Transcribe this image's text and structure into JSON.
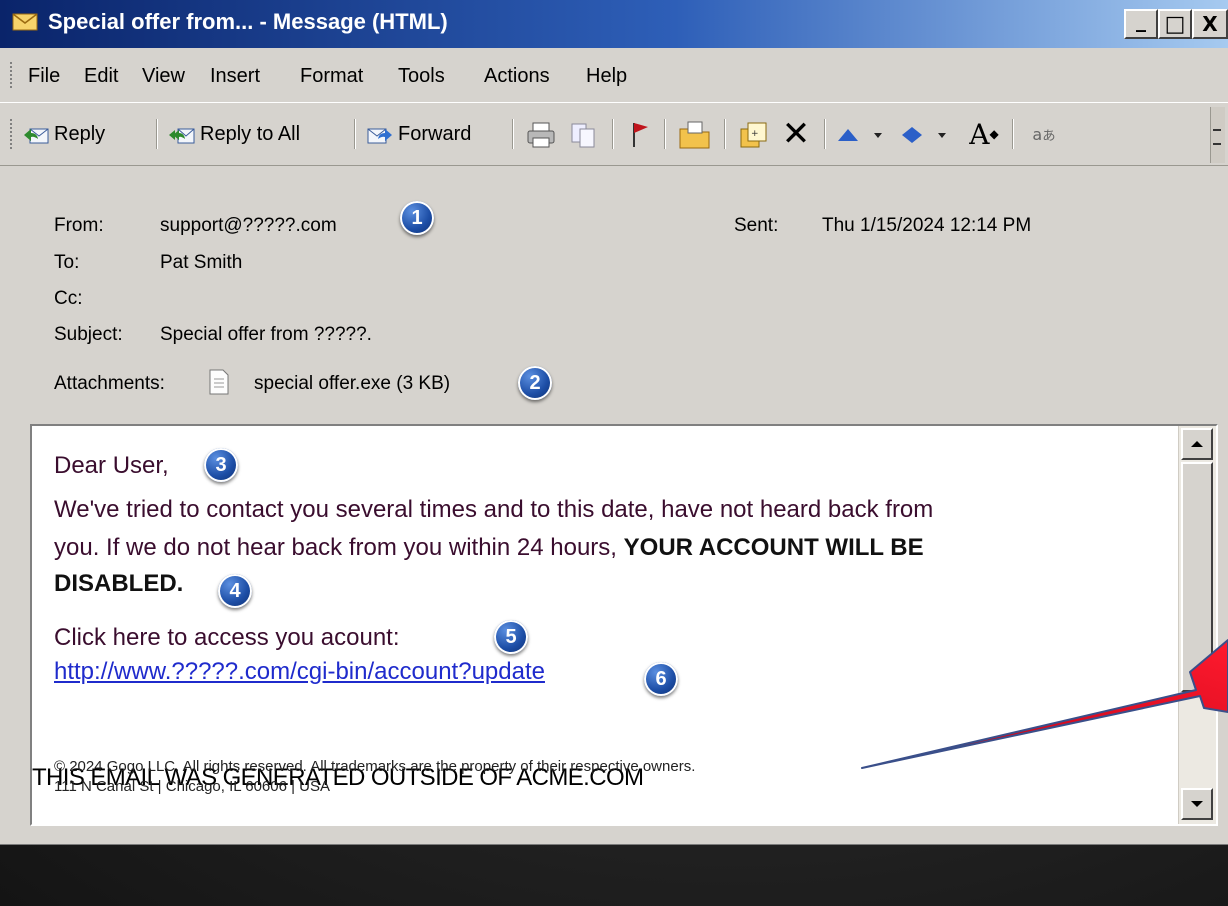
{
  "window": {
    "title": "Special offer from... - Message (HTML)",
    "controls": {
      "minimize": "_",
      "maximize": "□",
      "close": "X"
    }
  },
  "menu": [
    {
      "label": "File"
    },
    {
      "label": "Edit"
    },
    {
      "label": "View"
    },
    {
      "label": "Insert"
    },
    {
      "label": "Format"
    },
    {
      "label": "Tools"
    },
    {
      "label": "Actions"
    },
    {
      "label": "Help"
    }
  ],
  "toolbar": {
    "reply": "Reply",
    "reply_all": "Reply to All",
    "forward": "Forward",
    "font_size_glyph": "A"
  },
  "header": {
    "from_label": "From:",
    "from_value": "support@?????.com",
    "to_label": "To:",
    "to_value": "Pat Smith",
    "cc_label": "Cc:",
    "subject_label": "Subject:",
    "subject_value": "Special offer from ?????.",
    "sent_label": "Sent:",
    "sent_value": "Thu 1/15/2024 12:14 PM",
    "attachments_label": "Attachments:",
    "attachment_name": "special offer.exe (3 KB)"
  },
  "badges": [
    "1",
    "2",
    "3",
    "4",
    "5",
    "6"
  ],
  "body": {
    "greeting": "Dear User,",
    "line1": "We've tried to contact you several times and to this date, have not heard back from",
    "line2_prefix": "you. If we do not hear back from you within 24 hours, ",
    "line2_bold": "YOUR ACCOUNT WILL BE",
    "line3_bold": "DISABLED.",
    "click_text": "Click here to access you acount:",
    "link": "http://www.?????.com/cgi-bin/account?update",
    "warning": "THIS EMAIL WAS GENERATED OUTSIDE OF ACME.COM",
    "footer1": "© 2024 Gogo LLC. All rights reserved. All trademarks are the property of their respective owners.",
    "footer2": "111 N Canal St | Chicago, IL 60606 | USA"
  },
  "colors": {
    "titlebar_start": "#0a246a",
    "titlebar_end": "#a6caf0",
    "badge": "#1d4ea6",
    "link": "#1f2bcc",
    "arrow": "#e8001a"
  },
  "icons": {
    "title": "envelope-icon",
    "reply": "reply-icon",
    "reply_all": "reply-all-icon",
    "forward": "forward-icon",
    "print": "print-icon",
    "copy": "copy-icon",
    "flag": "flag-icon",
    "move": "move-to-folder-icon",
    "categorize": "categorize-icon",
    "delete": "delete-icon",
    "previous": "previous-item-icon",
    "next": "next-item-icon",
    "font_size": "font-size-icon",
    "encoding": "encoding-icon",
    "attachment": "attachment-file-icon"
  }
}
